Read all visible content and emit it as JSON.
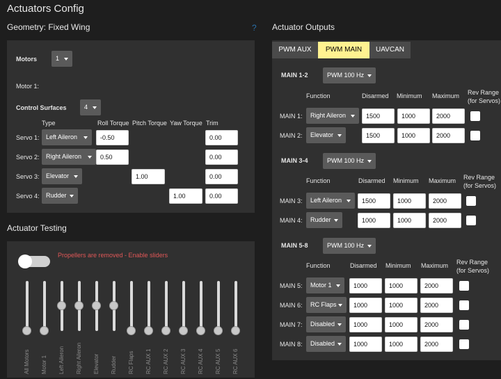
{
  "page": {
    "title": "Actuators Config",
    "geometry_heading": "Geometry: Fixed Wing",
    "help_glyph": "?",
    "outputs_heading": "Actuator Outputs",
    "testing_heading": "Actuator Testing"
  },
  "geometry": {
    "motors_label": "Motors",
    "motors_count": "1",
    "motor1_label": "Motor 1:",
    "control_surfaces_label": "Control Surfaces",
    "control_surfaces_count": "4",
    "columns": {
      "type": "Type",
      "roll": "Roll Torque",
      "pitch": "Pitch Torque",
      "yaw": "Yaw Torque",
      "trim": "Trim"
    },
    "servos": [
      {
        "label": "Servo 1:",
        "type": "Left Aileron",
        "roll": "-0.50",
        "pitch": "",
        "yaw": "",
        "trim": "0.00"
      },
      {
        "label": "Servo 2:",
        "type": "Right Aileron",
        "roll": "0.50",
        "pitch": "",
        "yaw": "",
        "trim": "0.00"
      },
      {
        "label": "Servo 3:",
        "type": "Elevator",
        "roll": "",
        "pitch": "1.00",
        "yaw": "",
        "trim": "0.00"
      },
      {
        "label": "Servo 4:",
        "type": "Rudder",
        "roll": "",
        "pitch": "",
        "yaw": "1.00",
        "trim": "0.00"
      }
    ]
  },
  "testing": {
    "warning": "Propellers are removed - Enable sliders",
    "warning_color": "#e05757",
    "sliders": [
      {
        "label": "All Motors",
        "level": 0.0
      },
      {
        "label": "Motor 1",
        "level": 0.0
      },
      {
        "label": "Left Aileron",
        "level": 0.5
      },
      {
        "label": "Right Aileron",
        "level": 0.5
      },
      {
        "label": "Elevator",
        "level": 0.5
      },
      {
        "label": "Rudder",
        "level": 0.5
      },
      {
        "label": "RC Flaps",
        "level": 0.0
      },
      {
        "label": "RC AUX 1",
        "level": 0.0
      },
      {
        "label": "RC AUX 2",
        "level": 0.0
      },
      {
        "label": "RC AUX 3",
        "level": 0.0
      },
      {
        "label": "RC AUX 4",
        "level": 0.0
      },
      {
        "label": "RC AUX 5",
        "level": 0.0
      },
      {
        "label": "RC AUX 6",
        "level": 0.0
      }
    ]
  },
  "outputs": {
    "tabs": [
      {
        "label": "PWM AUX",
        "active": false
      },
      {
        "label": "PWM MAIN",
        "active": true
      },
      {
        "label": "UAVCAN",
        "active": false
      }
    ],
    "active_tab_color": "#fff291",
    "col_function": "Function",
    "col_disarmed": "Disarmed",
    "col_minimum": "Minimum",
    "col_maximum": "Maximum",
    "col_rev_range_line1": "Rev Range",
    "col_rev_range_line2": "(for Servos)",
    "groups": [
      {
        "name": "MAIN 1-2",
        "rate": "PWM 100 Hz",
        "rows": [
          {
            "label": "MAIN 1:",
            "function": "Right Aileron",
            "disarmed": "1500",
            "min": "1000",
            "max": "2000"
          },
          {
            "label": "MAIN 2:",
            "function": "Elevator",
            "disarmed": "1500",
            "min": "1000",
            "max": "2000"
          }
        ]
      },
      {
        "name": "MAIN 3-4",
        "rate": "PWM 100 Hz",
        "rows": [
          {
            "label": "MAIN 3:",
            "function": "Left Aileron",
            "disarmed": "1500",
            "min": "1000",
            "max": "2000"
          },
          {
            "label": "MAIN 4:",
            "function": "Rudder",
            "disarmed": "1000",
            "min": "1000",
            "max": "2000"
          }
        ]
      },
      {
        "name": "MAIN 5-8",
        "rate": "PWM 100 Hz",
        "rows": [
          {
            "label": "MAIN 5:",
            "function": "Motor 1",
            "disarmed": "1000",
            "min": "1000",
            "max": "2000"
          },
          {
            "label": "MAIN 6:",
            "function": "RC Flaps",
            "disarmed": "1000",
            "min": "1000",
            "max": "2000"
          },
          {
            "label": "MAIN 7:",
            "function": "Disabled",
            "disarmed": "1000",
            "min": "1000",
            "max": "2000"
          },
          {
            "label": "MAIN 8:",
            "function": "Disabled",
            "disarmed": "1000",
            "min": "1000",
            "max": "2000"
          }
        ]
      }
    ]
  }
}
